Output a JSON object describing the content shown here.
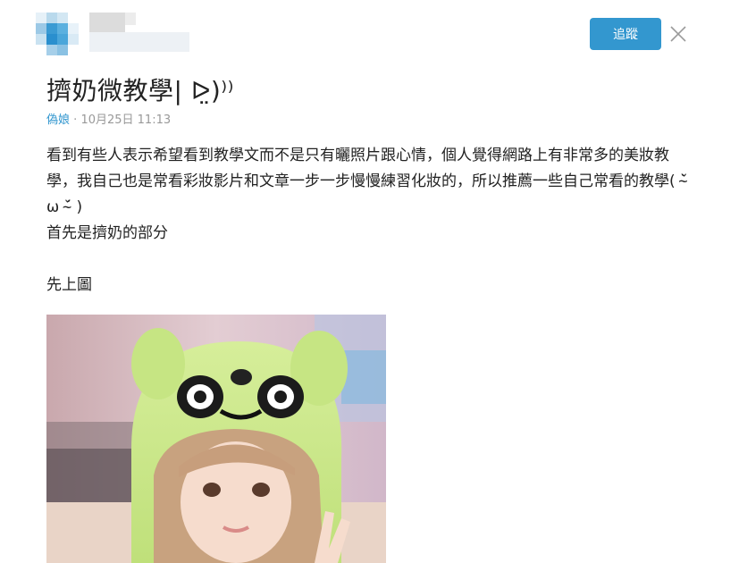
{
  "header": {
    "follow_label": "追蹤"
  },
  "article": {
    "title": "擠奶微教學| ᐅ̤)⁾⁾",
    "board": "偽娘",
    "separator": "·",
    "date": "10月25日 11:13",
    "paragraph1": "看到有些人表示希望看到教學文而不是只有曬照片跟心情，個人覺得網路上有非常多的美妝教學，我自己也是常看彩妝影片和文章一步一步慢慢練習化妝的，所以推薦一些自己常看的教學( ˘̴̀ ω ˘̴́ )",
    "paragraph2": "首先是擠奶的部分",
    "paragraph3": "先上圖"
  },
  "colors": {
    "accent": "#3397cf",
    "meta_gray": "#999999"
  },
  "icons": {
    "close": "close-icon"
  }
}
